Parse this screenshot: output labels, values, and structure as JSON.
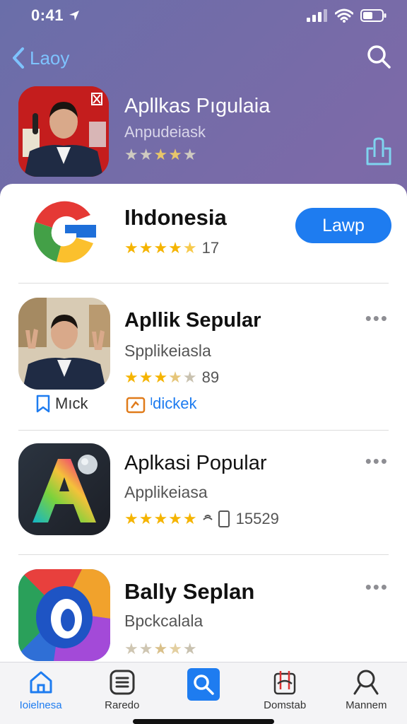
{
  "status": {
    "time": "0:41"
  },
  "nav": {
    "back_label": "Laoy"
  },
  "featured": {
    "title": "Apllkas Pıgulaia",
    "subtitle": "Anpudeiask",
    "rating": 3.5
  },
  "apps": [
    {
      "title": "Ihdonesia",
      "rating": 4.5,
      "rating_count": "17",
      "get_label": "Lawp"
    },
    {
      "title": "Apllik Sepular",
      "subtitle": "Spplikeiasla",
      "rating": 3.5,
      "rating_count": "89",
      "actions": [
        {
          "label": "Mıck"
        },
        {
          "label": "ᴵdickek"
        }
      ]
    },
    {
      "title": "Aplkasi Popular",
      "subtitle": "Applikeiasa",
      "rating": 5,
      "rating_count": "15529"
    },
    {
      "title": "Bally Seplan",
      "subtitle": "Bpckcalala",
      "rating": 3
    }
  ],
  "tabs": [
    {
      "label": "Ioielnesa",
      "icon": "home-icon"
    },
    {
      "label": "Raredo",
      "icon": "list-icon"
    },
    {
      "label": "",
      "icon": "search-icon"
    },
    {
      "label": "Domstab",
      "icon": "tools-icon"
    },
    {
      "label": "Mannem",
      "icon": "magnifier-icon"
    }
  ],
  "colors": {
    "accent": "#1e7cf0",
    "star": "#f5b400"
  }
}
